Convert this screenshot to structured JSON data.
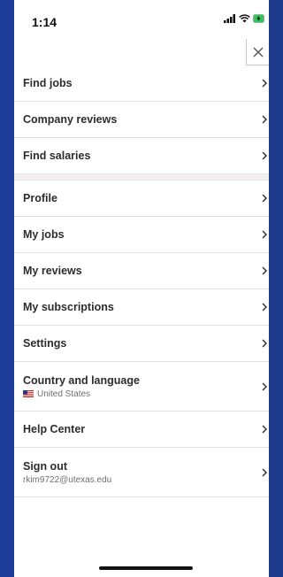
{
  "status_bar": {
    "time": "1:14",
    "icons": [
      "signal-icon",
      "wifi-icon",
      "battery-charging-icon"
    ]
  },
  "close_icon": "close-icon",
  "menu": {
    "primary": [
      {
        "label": "Find jobs"
      },
      {
        "label": "Company reviews"
      },
      {
        "label": "Find salaries"
      }
    ],
    "account": [
      {
        "label": "Profile"
      },
      {
        "label": "My jobs"
      },
      {
        "label": "My reviews"
      },
      {
        "label": "My subscriptions"
      },
      {
        "label": "Settings"
      },
      {
        "label": "Country and language",
        "sub": "United States",
        "sub_icon": "us-flag-icon"
      },
      {
        "label": "Help Center"
      },
      {
        "label": "Sign out",
        "sub": "rkim9722@utexas.edu"
      }
    ]
  },
  "colors": {
    "background": "#1e3a8a",
    "panel": "#ffffff",
    "text": "#2d2d2d",
    "subtext": "#6f6f6f",
    "divider": "#e4e2e0",
    "section_gap": "#f3eef0"
  }
}
